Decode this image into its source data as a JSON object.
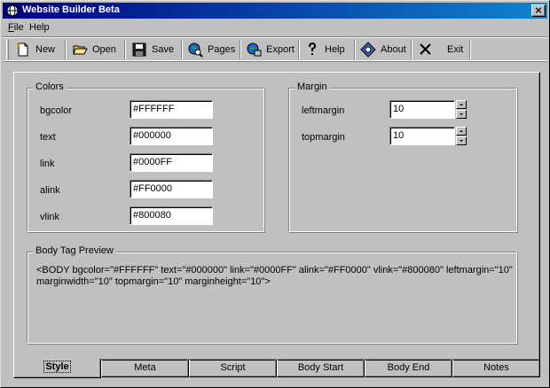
{
  "window": {
    "title": "Website Builder Beta",
    "close_glyph": "×"
  },
  "menu": [
    {
      "accel": "F",
      "rest": "ile"
    },
    {
      "accel": "",
      "rest": "Help"
    }
  ],
  "toolbar": {
    "buttons": [
      {
        "label": "New",
        "icon": "new-document-icon"
      },
      {
        "label": "Open",
        "icon": "open-folder-icon"
      },
      {
        "label": "Save",
        "icon": "floppy-disk-icon"
      },
      {
        "label": "Pages",
        "icon": "globe-search-icon"
      },
      {
        "label": "Export",
        "icon": "globe-export-icon"
      },
      {
        "label": "Help",
        "icon": "question-mark-icon"
      },
      {
        "label": "About",
        "icon": "about-eye-icon"
      },
      {
        "label": "Exit",
        "icon": "close-x-icon"
      }
    ]
  },
  "colors_group": {
    "title": "Colors",
    "fields": [
      {
        "label": "bgcolor",
        "value": "#FFFFFF"
      },
      {
        "label": "text",
        "value": "#000000"
      },
      {
        "label": "link",
        "value": "#0000FF"
      },
      {
        "label": "alink",
        "value": "#FF0000"
      },
      {
        "label": "vlink",
        "value": "#800080"
      }
    ]
  },
  "margin_group": {
    "title": "Margin",
    "fields": [
      {
        "label": "leftmargin",
        "value": "10"
      },
      {
        "label": "topmargin",
        "value": "10"
      }
    ]
  },
  "preview_group": {
    "title": "Body Tag Preview",
    "text": "<BODY bgcolor=\"#FFFFFF\" text=\"#000000\" link=\"#0000FF\" alink=\"#FF0000\" vlink=\"#800080\" leftmargin=\"10\" marginwidth=\"10\" topmargin=\"10\" marginheight=\"10\">"
  },
  "tabs": [
    {
      "label": "Style",
      "active": true
    },
    {
      "label": "Meta",
      "active": false
    },
    {
      "label": "Script",
      "active": false
    },
    {
      "label": "Body Start",
      "active": false
    },
    {
      "label": "Body End",
      "active": false
    },
    {
      "label": "Notes",
      "active": false
    }
  ],
  "theme": {
    "face": "#c0c0c0",
    "title_gradient_start": "#000080",
    "title_gradient_end": "#1084d0"
  }
}
